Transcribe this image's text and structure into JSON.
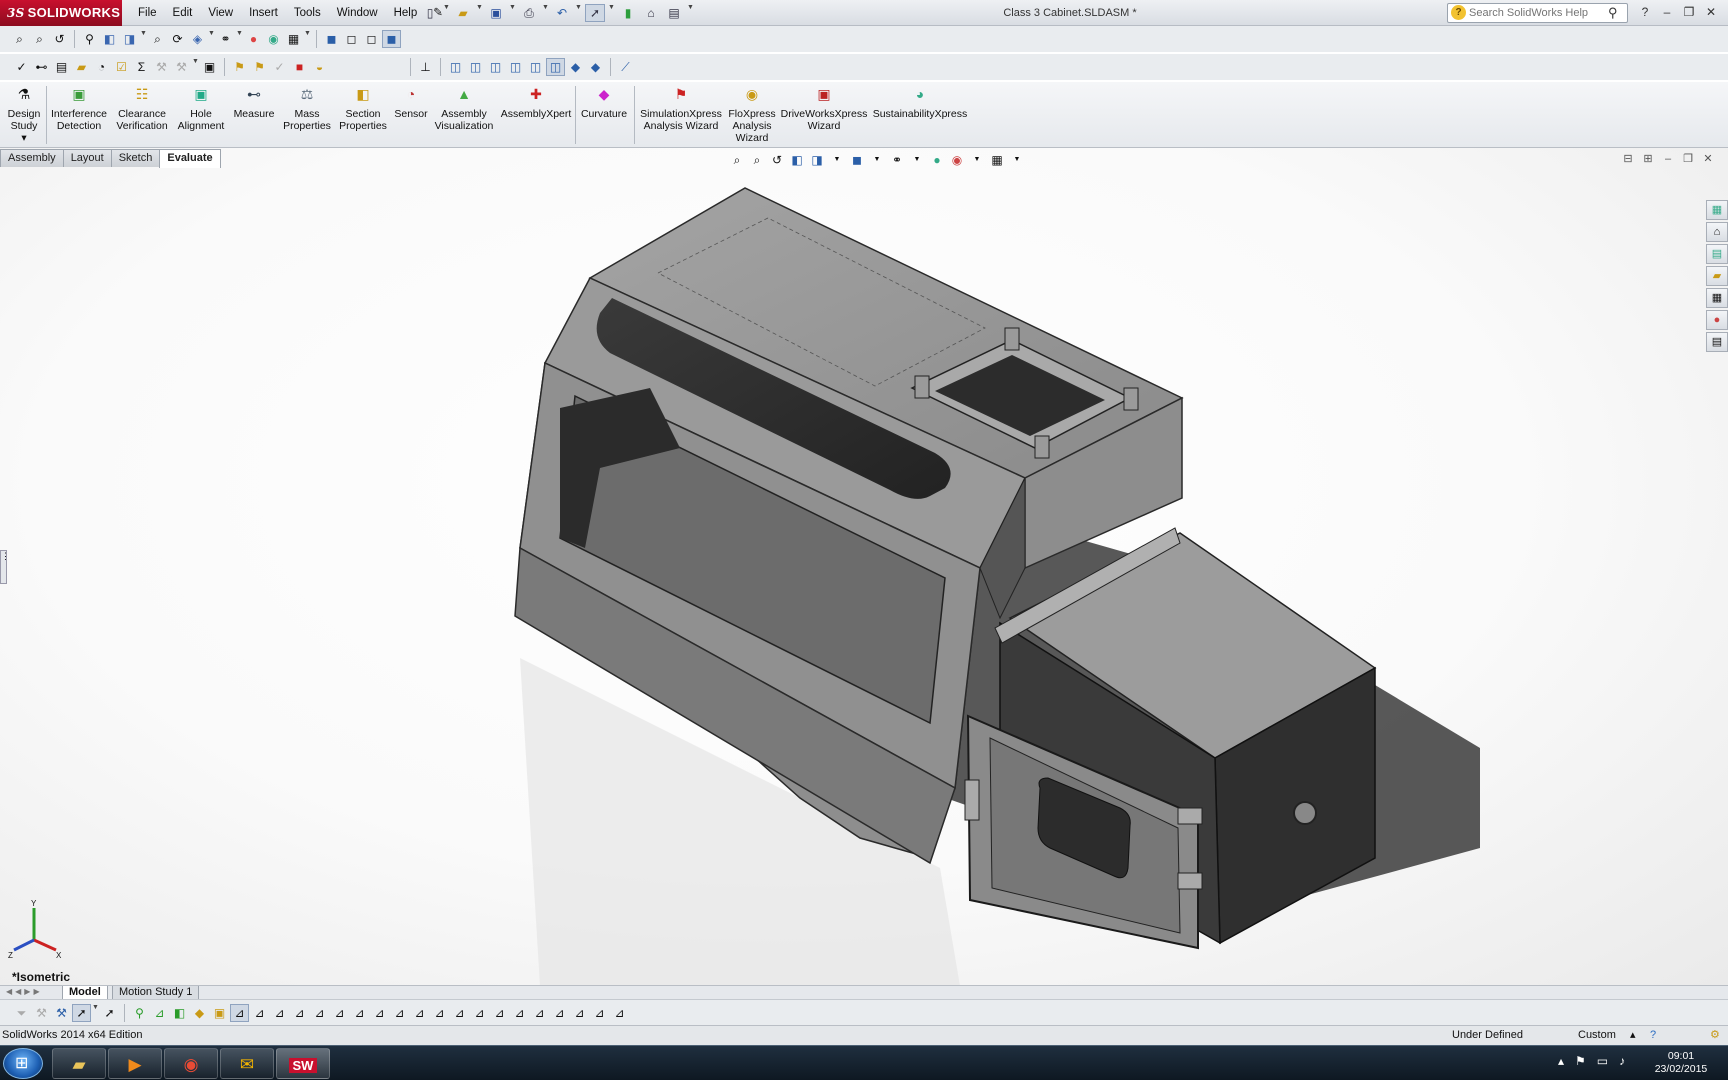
{
  "app": {
    "brand": "SOLIDWORKS",
    "brand_prefix": "3S",
    "window_title": "Class 3 Cabinet.SLDASM *",
    "menu": [
      "File",
      "Edit",
      "View",
      "Insert",
      "Tools",
      "Window",
      "Help"
    ],
    "help_search_placeholder": "Search SolidWorks Help"
  },
  "command_manager": {
    "commands": [
      {
        "label": "Design Study",
        "icon": "design-study-icon"
      },
      {
        "label": "Interference Detection",
        "icon": "interference-detection-icon"
      },
      {
        "label": "Clearance Verification",
        "icon": "clearance-verification-icon"
      },
      {
        "label": "Hole Alignment",
        "icon": "hole-alignment-icon"
      },
      {
        "label": "Measure",
        "icon": "measure-icon"
      },
      {
        "label": "Mass Properties",
        "icon": "mass-properties-icon"
      },
      {
        "label": "Section Properties",
        "icon": "section-properties-icon"
      },
      {
        "label": "Sensor",
        "icon": "sensor-icon"
      },
      {
        "label": "Assembly Visualization",
        "icon": "assembly-visualization-icon"
      },
      {
        "label": "AssemblyXpert",
        "icon": "assemblyxpert-icon"
      },
      {
        "label": "Curvature",
        "icon": "curvature-icon"
      },
      {
        "label": "SimulationXpress Analysis Wizard",
        "icon": "simulationxpress-icon"
      },
      {
        "label": "FloXpress Analysis Wizard",
        "icon": "floxpress-icon"
      },
      {
        "label": "DriveWorksXpress Wizard",
        "icon": "driveworksxpress-icon"
      },
      {
        "label": "SustainabilityXpress",
        "icon": "sustainabilityxpress-icon"
      }
    ],
    "tabs": [
      "Assembly",
      "Layout",
      "Sketch",
      "Evaluate"
    ],
    "active_tab": "Evaluate"
  },
  "viewport": {
    "view_name": "*Isometric",
    "axis_labels": {
      "x": "X",
      "y": "Y",
      "z": "Z"
    }
  },
  "bottom_tabs": [
    "Model",
    "Motion Study 1"
  ],
  "status_bar": {
    "edition": "SolidWorks 2014 x64 Edition",
    "state": "Under Defined",
    "units": "Custom"
  },
  "taskbar": {
    "apps": [
      "file-explorer-icon",
      "media-player-icon",
      "chrome-icon",
      "outlook-icon",
      "solidworks-icon"
    ],
    "active_app": "solidworks-icon",
    "time": "09:01",
    "date": "23/02/2015"
  },
  "colors": {
    "brand_red": "#c8102e",
    "toolbar_bg": "#e9ecef",
    "taskbar_bg": "#16222e",
    "model_gray": "#8a8a8a"
  }
}
